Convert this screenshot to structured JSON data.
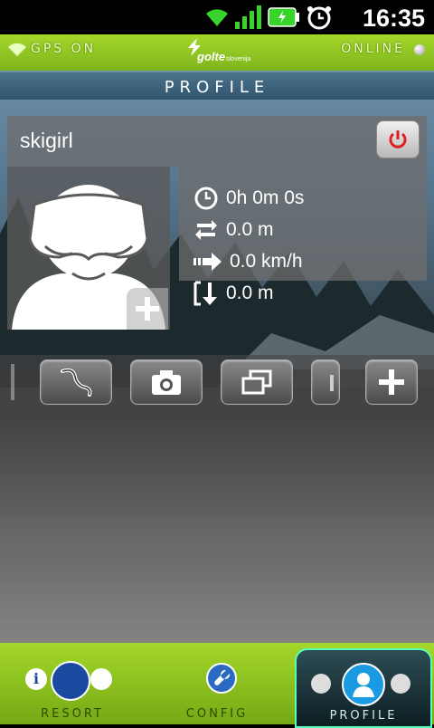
{
  "status_bar": {
    "time": "16:35"
  },
  "top_bar": {
    "gps_status": "GPS ON",
    "logo_text": "golte",
    "logo_sub": "slovenija",
    "connection_status": "ONLINE"
  },
  "title": "PROFILE",
  "profile": {
    "username": "skigirl",
    "stats": {
      "time": "0h 0m 0s",
      "distance": "0.0 m",
      "speed": "0.0 km/h",
      "vertical": "0.0 m"
    }
  },
  "bottom_nav": {
    "items": [
      {
        "label": "RESORT"
      },
      {
        "label": "CONFIG"
      },
      {
        "label": "PROFILE"
      }
    ]
  },
  "colors": {
    "accent_green": "#a4d82a",
    "power_red": "#e02020"
  }
}
